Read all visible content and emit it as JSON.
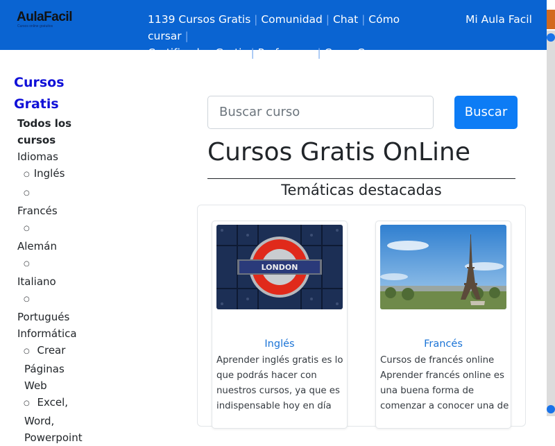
{
  "header": {
    "logo_text": "AulaFacil",
    "logo_tagline": "Cursos online gratuitos",
    "nav_items": [
      "1139 Cursos Gratis",
      "Comunidad",
      "Chat",
      "Cómo cursar",
      "Certificados Gratis",
      "Profesores",
      "Crear Curso"
    ],
    "account_link": "Mi Aula Facil",
    "brand_color": "#0a64d2"
  },
  "sidebar": {
    "title_line1": "Cursos",
    "title_line2": "Gratis",
    "all_courses_line1": "Todos los",
    "all_courses_line2": "cursos",
    "categories": [
      {
        "label": "Idiomas"
      },
      {
        "label": "Inglés"
      },
      {
        "label": "Francés"
      },
      {
        "label": "Alemán"
      },
      {
        "label": "Italiano"
      },
      {
        "label": "Portugués"
      },
      {
        "label": "Informática"
      }
    ],
    "crear_paginas_lines": [
      "Crear",
      "Páginas",
      "Web"
    ],
    "excel_lines": [
      "Excel,",
      "Word,",
      "Powerpoint"
    ]
  },
  "search": {
    "placeholder": "Buscar curso",
    "button_label": "Buscar"
  },
  "main": {
    "page_title": "Cursos Gratis OnLine",
    "section_title": "Temáticas destacadas"
  },
  "cards": [
    {
      "title": "Inglés",
      "image": "london-underground-sign",
      "text": "Aprender inglés gratis es lo que podrás hacer con nuestros cursos, ya que es indispensable hoy en día"
    },
    {
      "title": "Francés",
      "image": "eiffel-tower-photo",
      "text": "Cursos de francés online Aprender francés online es una buena forma de comenzar a conocer una de"
    }
  ],
  "card_image_labels": {
    "london": "LONDON"
  }
}
